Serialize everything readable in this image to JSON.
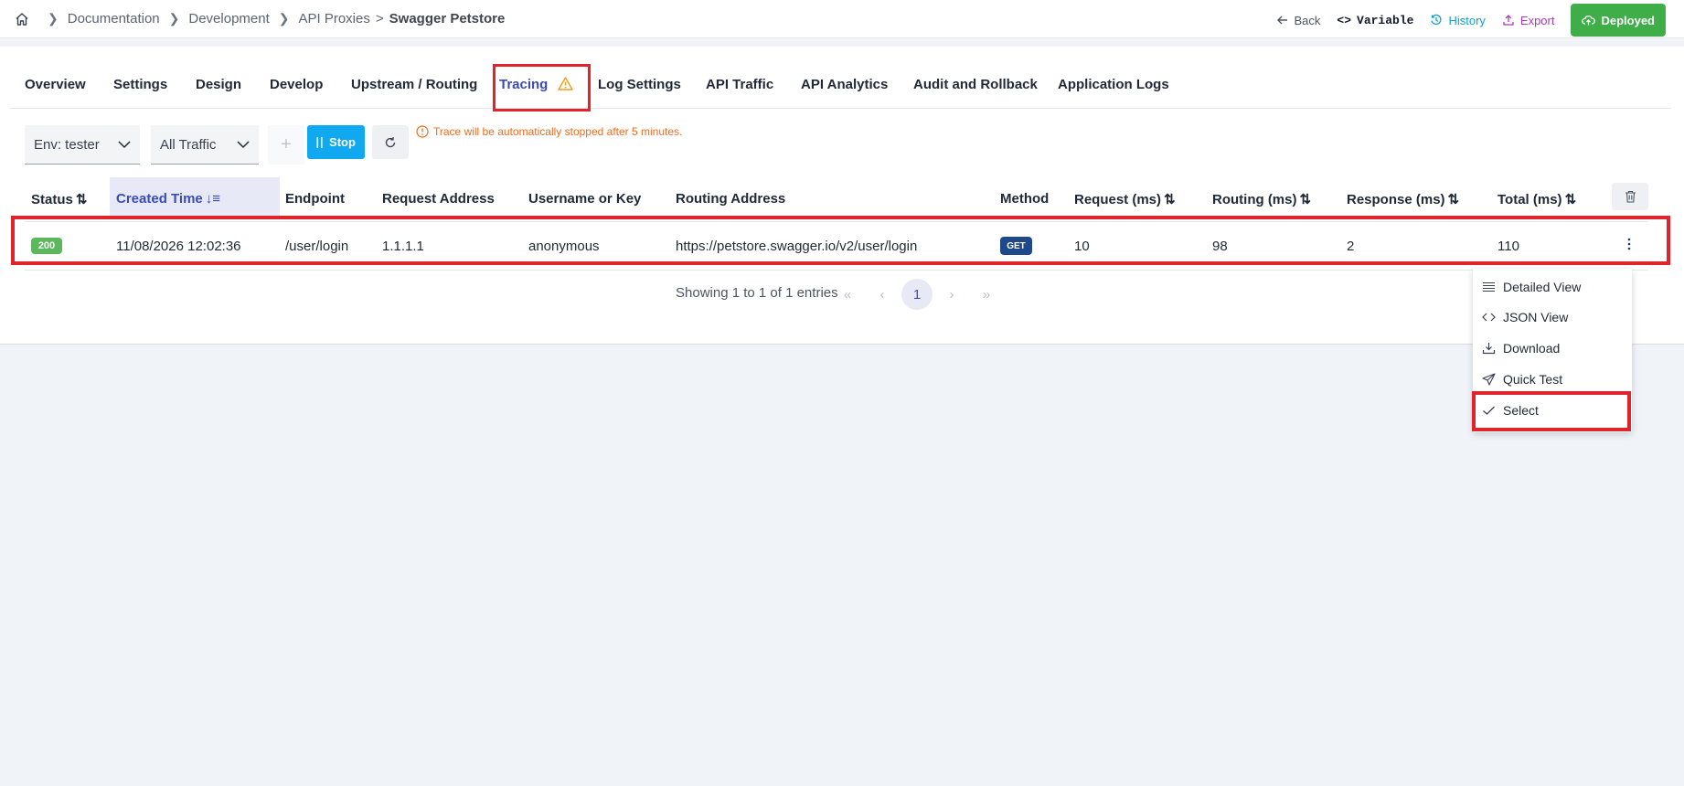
{
  "breadcrumb": {
    "items": [
      "Documentation",
      "Development",
      "API Proxies"
    ],
    "separator_last": ">",
    "current": "Swagger Petstore"
  },
  "header_actions": {
    "back": "Back",
    "variable": "Variable",
    "history": "History",
    "export": "Export",
    "deployed": "Deployed"
  },
  "tabs": [
    {
      "label": "Overview"
    },
    {
      "label": "Settings"
    },
    {
      "label": "Design"
    },
    {
      "label": "Develop"
    },
    {
      "label": "Upstream / Routing"
    },
    {
      "label": "Tracing",
      "active": true,
      "icon": "warning-icon"
    },
    {
      "label": "Log Settings"
    },
    {
      "label": "API Traffic"
    },
    {
      "label": "API Analytics"
    },
    {
      "label": "Audit and Rollback"
    },
    {
      "label": "Application Logs"
    }
  ],
  "toolbar": {
    "env_select": "Env: tester",
    "traffic_select": "All Traffic",
    "stop_label": "Stop",
    "notice": "Trace will be automatically stopped after 5 minutes."
  },
  "table": {
    "columns": [
      "Status",
      "Created Time",
      "Endpoint",
      "Request Address",
      "Username or Key",
      "Routing Address",
      "Method",
      "Request (ms)",
      "Routing (ms)",
      "Response (ms)",
      "Total (ms)"
    ],
    "sorted_column": "Created Time",
    "rows": [
      {
        "status": "200",
        "created_time": "11/08/2026 12:02:36",
        "endpoint": "/user/login",
        "request_address": "1.1.1.1",
        "username": "anonymous",
        "routing_address": "https://petstore.swagger.io/v2/user/login",
        "method": "GET",
        "request_ms": "10",
        "routing_ms": "98",
        "response_ms": "2",
        "total_ms": "110"
      }
    ]
  },
  "pagination": {
    "summary": "Showing 1 to 1 of 1 entries",
    "current_page": "1"
  },
  "row_menu": {
    "items": [
      "Detailed View",
      "JSON View",
      "Download",
      "Quick Test",
      "Select"
    ]
  },
  "colors": {
    "accent": "#3b4bb6",
    "highlight": "#e0242b",
    "deployed": "#3fae49",
    "stop": "#10a8ef",
    "status_ok": "#5cb85c",
    "method_get": "#1e4a8c",
    "notice": "#ef6b1f"
  }
}
